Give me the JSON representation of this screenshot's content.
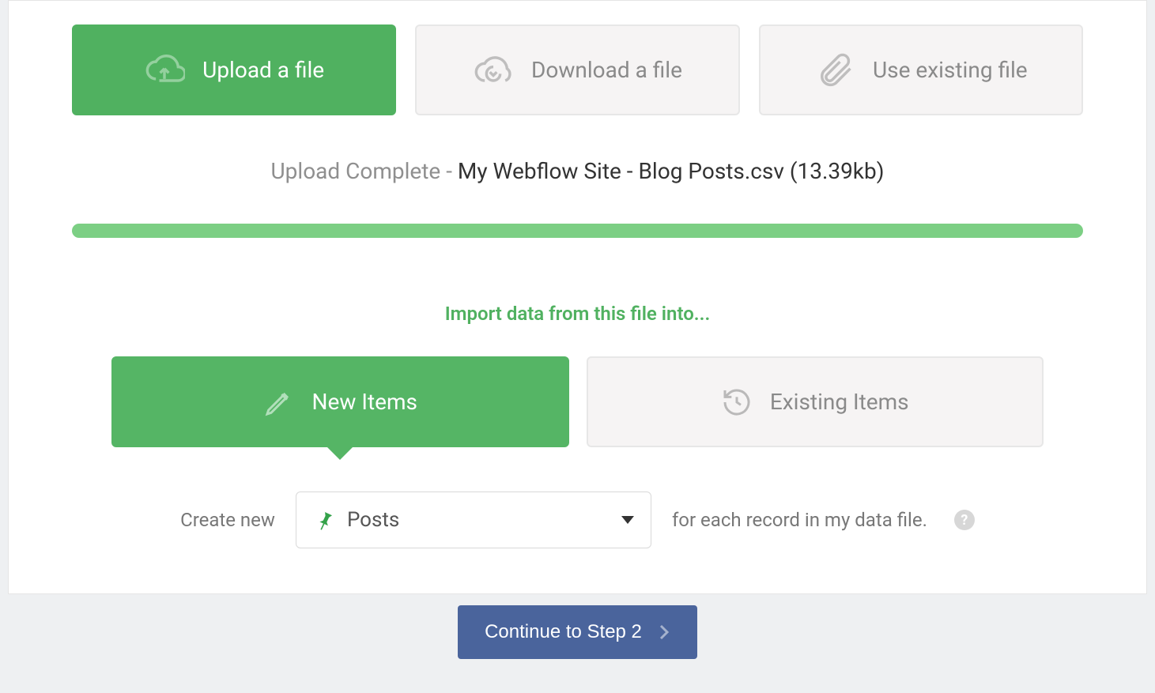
{
  "source_tabs": {
    "upload": "Upload a file",
    "download": "Download a file",
    "existing": "Use existing file"
  },
  "status": {
    "prefix": "Upload Complete",
    "separator": " - ",
    "filename": "My Webflow Site - Blog Posts.csv",
    "size": "(13.39kb)"
  },
  "import_heading": "Import data from this file into...",
  "target_tabs": {
    "new": "New Items",
    "existing": "Existing Items"
  },
  "create_row": {
    "prefix": "Create new",
    "selected": "Posts",
    "suffix": "for each record in my data file."
  },
  "continue_label": "Continue to Step 2",
  "help_glyph": "?"
}
